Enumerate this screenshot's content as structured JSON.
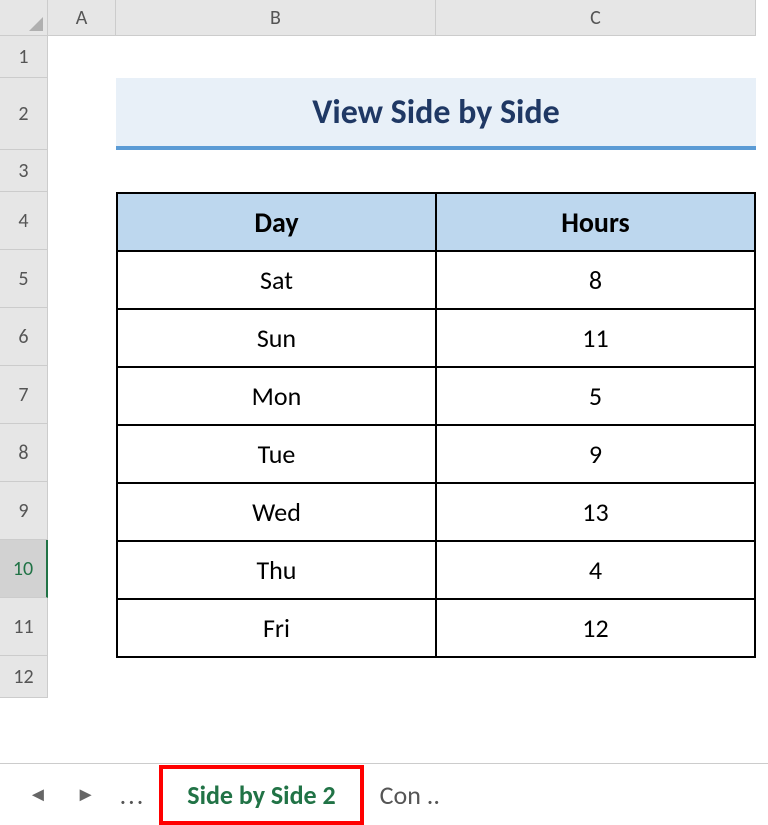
{
  "columns": [
    "A",
    "B",
    "C"
  ],
  "rows": [
    "1",
    "2",
    "3",
    "4",
    "5",
    "6",
    "7",
    "8",
    "9",
    "10",
    "11",
    "12"
  ],
  "activeRow": "10",
  "title": "View Side by Side",
  "table": {
    "headers": {
      "day": "Day",
      "hours": "Hours"
    },
    "data": [
      {
        "day": "Sat",
        "hours": "8"
      },
      {
        "day": "Sun",
        "hours": "11"
      },
      {
        "day": "Mon",
        "hours": "5"
      },
      {
        "day": "Tue",
        "hours": "9"
      },
      {
        "day": "Wed",
        "hours": "13"
      },
      {
        "day": "Thu",
        "hours": "4"
      },
      {
        "day": "Fri",
        "hours": "12"
      }
    ]
  },
  "tabs": {
    "navDots": "...",
    "active": "Side by Side 2",
    "other": "Con .."
  },
  "chart_data": {
    "type": "table",
    "title": "View Side by Side",
    "columns": [
      "Day",
      "Hours"
    ],
    "rows": [
      [
        "Sat",
        8
      ],
      [
        "Sun",
        11
      ],
      [
        "Mon",
        5
      ],
      [
        "Tue",
        9
      ],
      [
        "Wed",
        13
      ],
      [
        "Thu",
        4
      ],
      [
        "Fri",
        12
      ]
    ]
  }
}
